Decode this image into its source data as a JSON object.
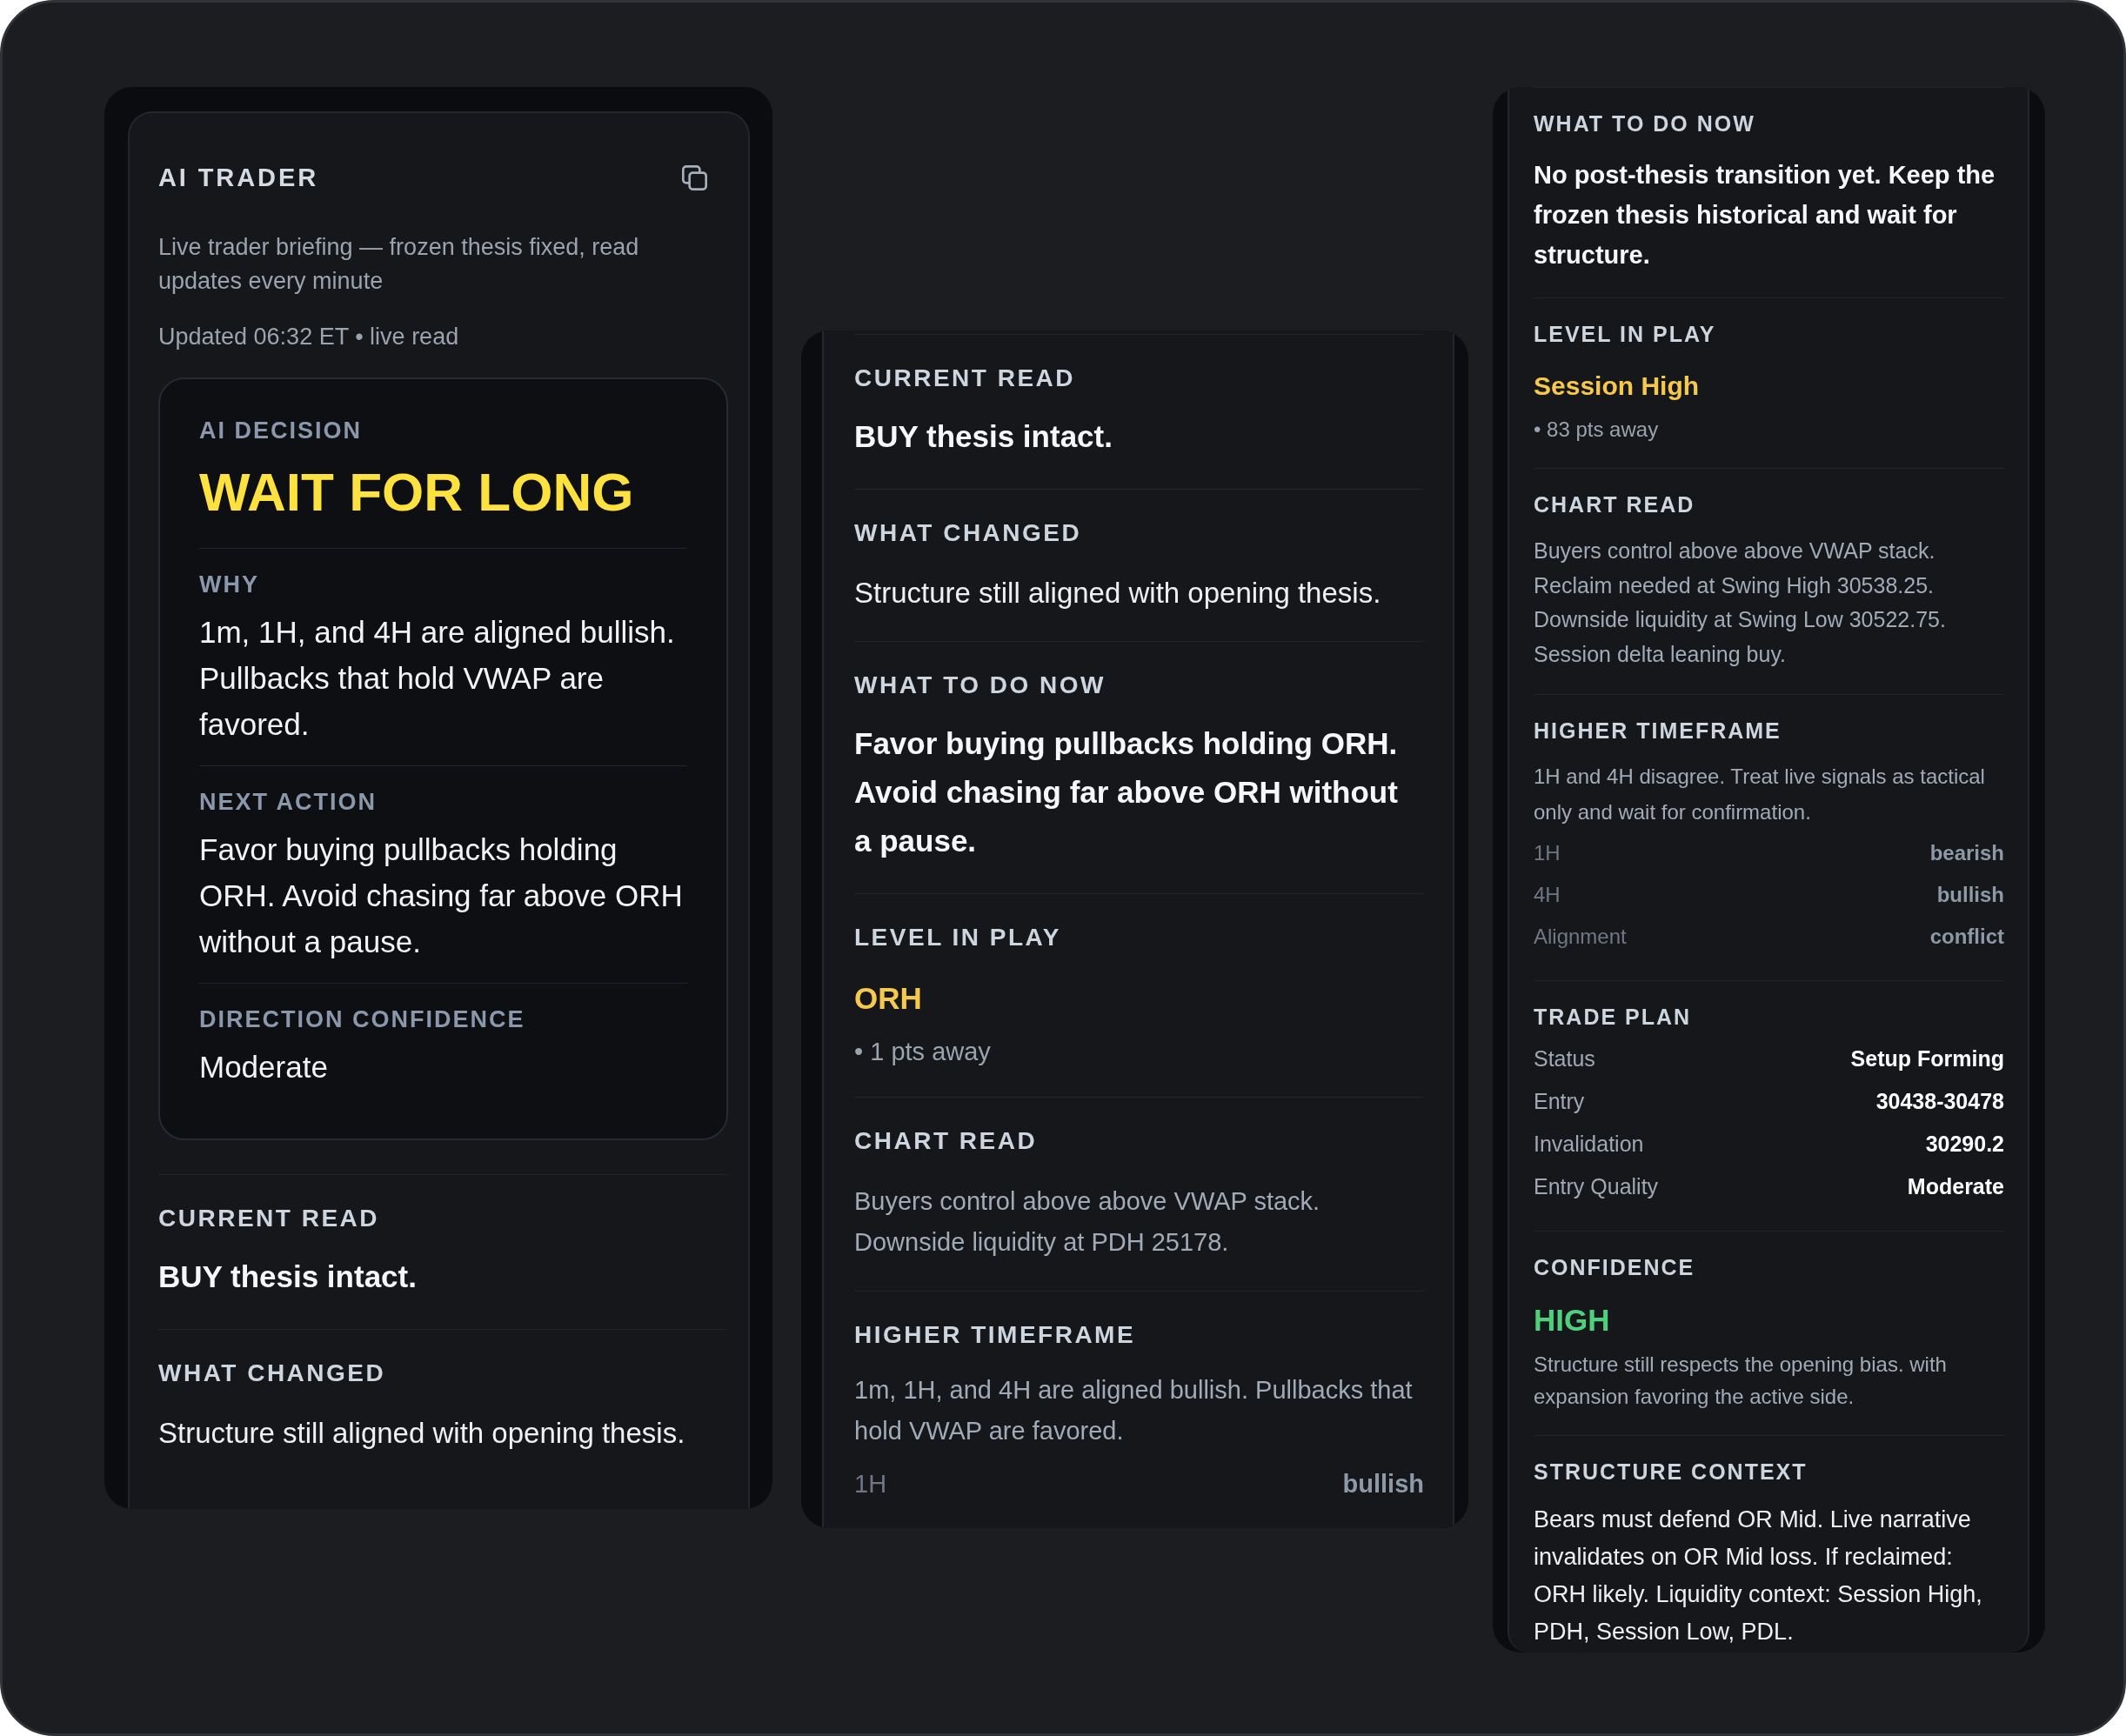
{
  "panels": [
    {
      "header": {
        "title": "AI TRADER",
        "subtitle": "Live trader briefing — frozen thesis fixed, read updates every minute",
        "updated": "Updated 06:32 ET • live read"
      },
      "decision": {
        "label": "AI DECISION",
        "value": "WAIT FOR LONG",
        "fields": [
          {
            "label": "WHY",
            "text": "1m, 1H, and 4H are aligned bullish. Pullbacks that hold VWAP are favored."
          },
          {
            "label": "NEXT ACTION",
            "text": "Favor buying pullbacks holding ORH. Avoid chasing far above ORH without a pause."
          },
          {
            "label": "DIRECTION CONFIDENCE",
            "text": "Moderate"
          }
        ]
      },
      "sections": [
        {
          "title": "CURRENT READ",
          "items": [
            {
              "kind": "lead",
              "text": "BUY thesis intact."
            }
          ]
        },
        {
          "title": "WHAT CHANGED",
          "items": [
            {
              "kind": "body",
              "text": "Structure still aligned with opening thesis."
            }
          ]
        }
      ]
    },
    {
      "sections": [
        {
          "title": "CURRENT READ",
          "items": [
            {
              "kind": "lead",
              "text": "BUY thesis intact."
            }
          ]
        },
        {
          "title": "WHAT CHANGED",
          "items": [
            {
              "kind": "body",
              "text": "Structure still aligned with opening thesis."
            }
          ]
        },
        {
          "title": "WHAT TO DO NOW",
          "items": [
            {
              "kind": "lead",
              "text": "Favor buying pullbacks holding ORH. Avoid chasing far above ORH without a pause."
            }
          ]
        },
        {
          "title": "LEVEL IN PLAY",
          "items": [
            {
              "kind": "level",
              "text": "ORH"
            },
            {
              "kind": "note",
              "text": "• 1 pts away"
            }
          ]
        },
        {
          "title": "CHART READ",
          "items": [
            {
              "kind": "lines",
              "lines": [
                "Buyers control above above VWAP stack.",
                "Downside liquidity at PDH 25178."
              ]
            }
          ]
        },
        {
          "title": "HIGHER TIMEFRAME",
          "items": [
            {
              "kind": "detail",
              "text": "1m, 1H, and 4H are aligned bullish. Pullbacks that hold VWAP are favored."
            },
            {
              "kind": "signals",
              "rows": [
                {
                  "label": "1H",
                  "value": "bullish"
                }
              ]
            }
          ]
        }
      ]
    },
    {
      "sections": [
        {
          "title": "WHAT TO DO NOW",
          "items": [
            {
              "kind": "lead",
              "text": "No post-thesis transition yet. Keep the frozen thesis historical and wait for structure."
            }
          ]
        },
        {
          "title": "LEVEL IN PLAY",
          "items": [
            {
              "kind": "level",
              "text": "Session High"
            },
            {
              "kind": "note",
              "text": "• 83 pts away"
            }
          ]
        },
        {
          "title": "CHART READ",
          "items": [
            {
              "kind": "lines",
              "lines": [
                "Buyers control above above VWAP stack.",
                "Reclaim needed at Swing High 30538.25.",
                "Downside liquidity at Swing Low 30522.75.",
                "Session delta leaning buy."
              ]
            }
          ]
        },
        {
          "title": "HIGHER TIMEFRAME",
          "items": [
            {
              "kind": "detail",
              "text": "1H and 4H disagree. Treat live signals as tactical only and wait for confirmation."
            },
            {
              "kind": "signals",
              "rows": [
                {
                  "label": "1H",
                  "value": "bearish"
                },
                {
                  "label": "4H",
                  "value": "bullish"
                },
                {
                  "label": "Alignment",
                  "value": "conflict"
                }
              ]
            }
          ]
        },
        {
          "title": "TRADE PLAN",
          "items": [
            {
              "kind": "plan",
              "rows": [
                {
                  "label": "Status",
                  "value": "Setup Forming"
                },
                {
                  "label": "Entry",
                  "value": "30438-30478"
                },
                {
                  "label": "Invalidation",
                  "value": "30290.2"
                },
                {
                  "label": "Entry Quality",
                  "value": "Moderate"
                }
              ]
            }
          ]
        },
        {
          "title": "CONFIDENCE",
          "items": [
            {
              "kind": "rating",
              "text": "HIGH"
            },
            {
              "kind": "detail",
              "text": "Structure still respects the opening bias. with expansion favoring the active side."
            }
          ]
        },
        {
          "title": "STRUCTURE CONTEXT",
          "items": [
            {
              "kind": "body",
              "text": "Bears must defend OR Mid. Live narrative invalidates on OR Mid loss. If reclaimed: ORH likely. Liquidity context: Session High, PDH, Session Low, PDL."
            }
          ]
        }
      ]
    }
  ]
}
